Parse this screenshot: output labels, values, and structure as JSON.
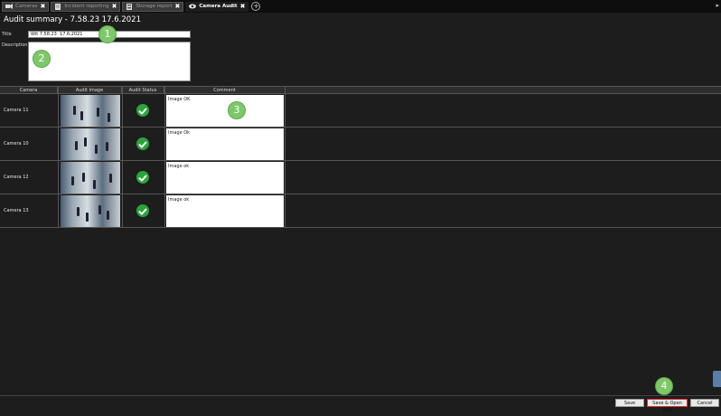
{
  "tabs": [
    {
      "label": "Cameras",
      "icon": "camera-icon",
      "active": false
    },
    {
      "label": "Incident reporting",
      "icon": "document-icon",
      "active": false
    },
    {
      "label": "Storage report",
      "icon": "storage-icon",
      "active": false
    },
    {
      "label": "Camera Audit",
      "icon": "eye-icon",
      "active": true
    }
  ],
  "page_title": "Audit summary - 7.58.23  17.6.2021",
  "form": {
    "title_label": "Title",
    "title_value": "Wit 7.58.23  17.6.2021",
    "description_label": "Description",
    "description_value": ""
  },
  "callouts": [
    "1",
    "2",
    "3",
    "4"
  ],
  "table": {
    "headers": [
      "Camera",
      "Audit Image",
      "Audit Status",
      "Comment"
    ],
    "rows": [
      {
        "camera": "Camera 11",
        "comment": "Image OK",
        "status": "ok"
      },
      {
        "camera": "Camera 10",
        "comment": "Image Ok",
        "status": "ok"
      },
      {
        "camera": "Camera 12",
        "comment": "Image ok",
        "status": "ok"
      },
      {
        "camera": "Camera 13",
        "comment": "Image ok",
        "status": "ok"
      }
    ]
  },
  "buttons": {
    "save": "Save",
    "save_open_pdf": "Save & Open PDF",
    "cancel": "Cancel"
  },
  "colors": {
    "background": "#1d1d1d",
    "check_green": "#2aa33a",
    "callout_green": "#7ec86a",
    "highlight_red": "#e03030"
  }
}
